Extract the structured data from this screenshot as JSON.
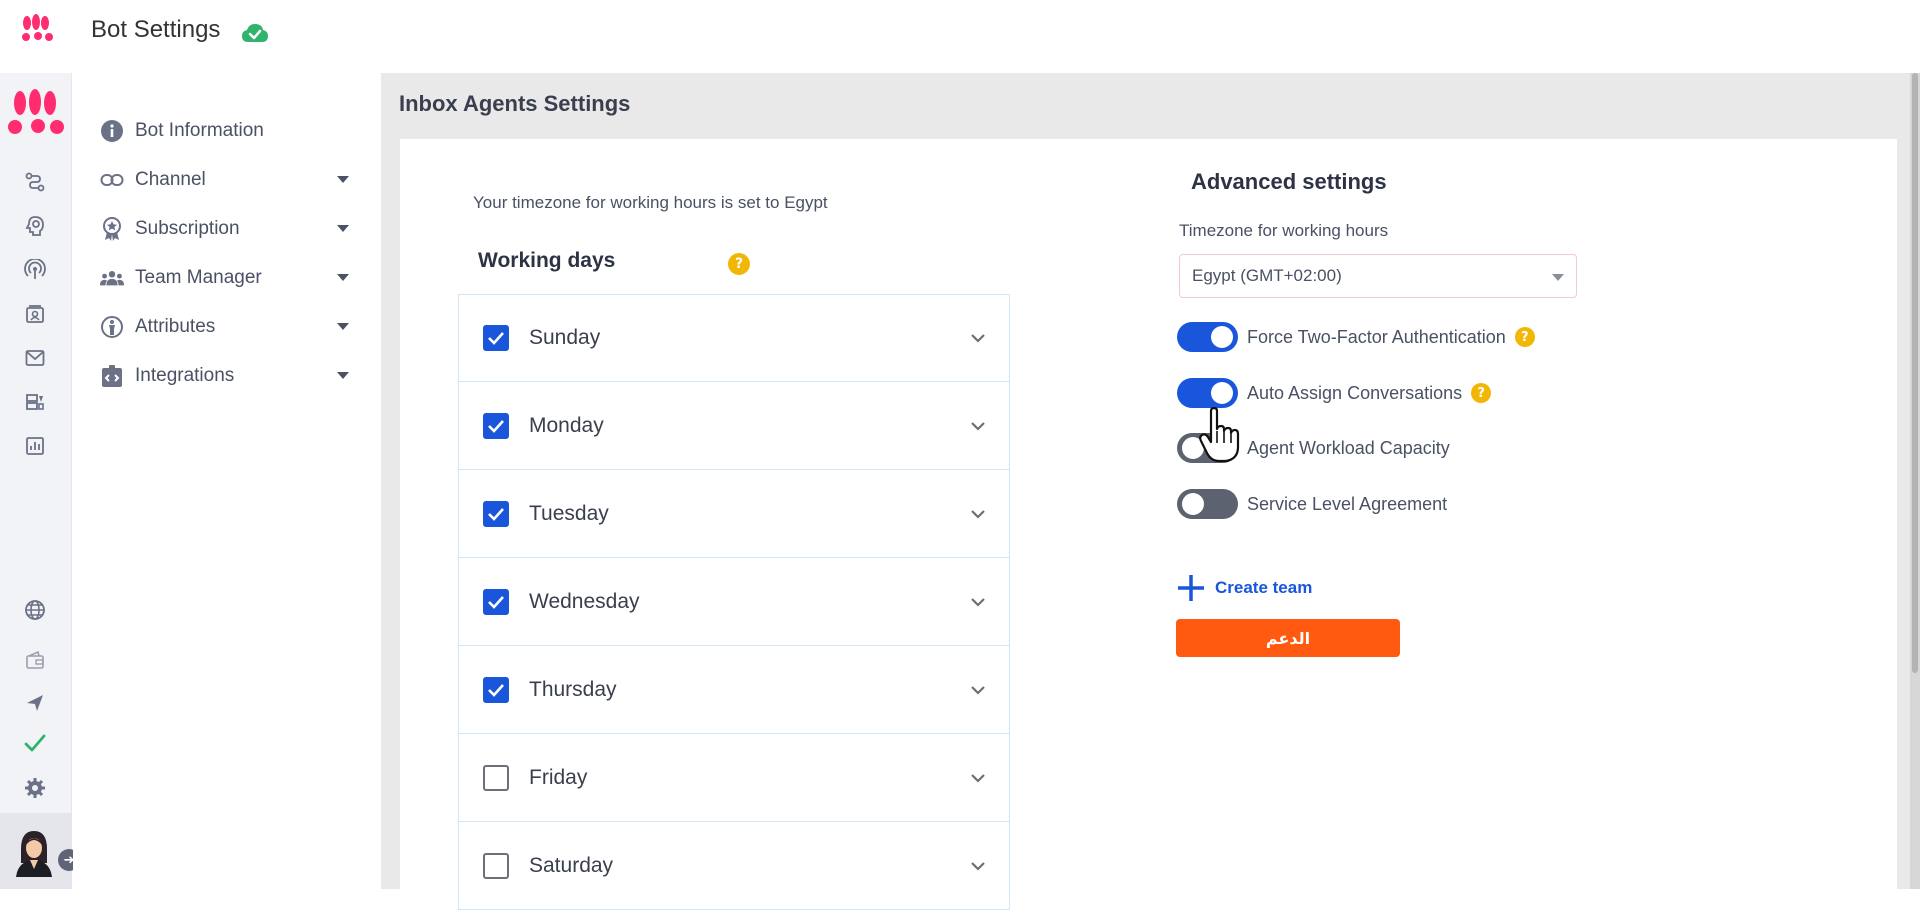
{
  "header": {
    "title": "Bot Settings",
    "status_icon": "cloud-check-icon",
    "brand_color": "#ff2d6f"
  },
  "rail": {
    "icons": [
      "workflow-icon",
      "bot-head-icon",
      "broadcast-icon",
      "contacts-icon",
      "mail-icon",
      "templates-icon",
      "analytics-icon",
      "globe-icon",
      "wallet-icon",
      "send-icon",
      "check-icon",
      "settings-icon"
    ]
  },
  "nav": {
    "items": [
      {
        "label": "Bot Information",
        "icon": "info-icon"
      },
      {
        "label": "Channel",
        "icon": "link-icon"
      },
      {
        "label": "Subscription",
        "icon": "badge-icon"
      },
      {
        "label": "Team Manager",
        "icon": "team-icon"
      },
      {
        "label": "Attributes",
        "icon": "attribute-icon"
      },
      {
        "label": "Integrations",
        "icon": "integrations-icon"
      }
    ]
  },
  "main": {
    "title": "Inbox Agents Settings",
    "timezone_note": "Your timezone for working hours is set to Egypt",
    "working_days_title": "Working days",
    "days": [
      {
        "label": "Sunday",
        "checked": true
      },
      {
        "label": "Monday",
        "checked": true
      },
      {
        "label": "Tuesday",
        "checked": true
      },
      {
        "label": "Wednesday",
        "checked": true
      },
      {
        "label": "Thursday",
        "checked": true
      },
      {
        "label": "Friday",
        "checked": false
      },
      {
        "label": "Saturday",
        "checked": false
      }
    ],
    "advanced": {
      "title": "Advanced settings",
      "timezone_label": "Timezone for working hours",
      "timezone_value": "Egypt (GMT+02:00)",
      "toggles": [
        {
          "label": "Force Two-Factor Authentication",
          "on": true,
          "help": true
        },
        {
          "label": "Auto Assign Conversations",
          "on": true,
          "help": true
        },
        {
          "label": "Agent Workload Capacity",
          "on": false,
          "help": false
        },
        {
          "label": "Service Level Agreement",
          "on": false,
          "help": false
        }
      ],
      "create_team_label": "Create team",
      "support_label": "الدعم"
    },
    "accent_color": "#1a56db",
    "support_color": "#ff5a0f",
    "help_color": "#f2b705"
  }
}
